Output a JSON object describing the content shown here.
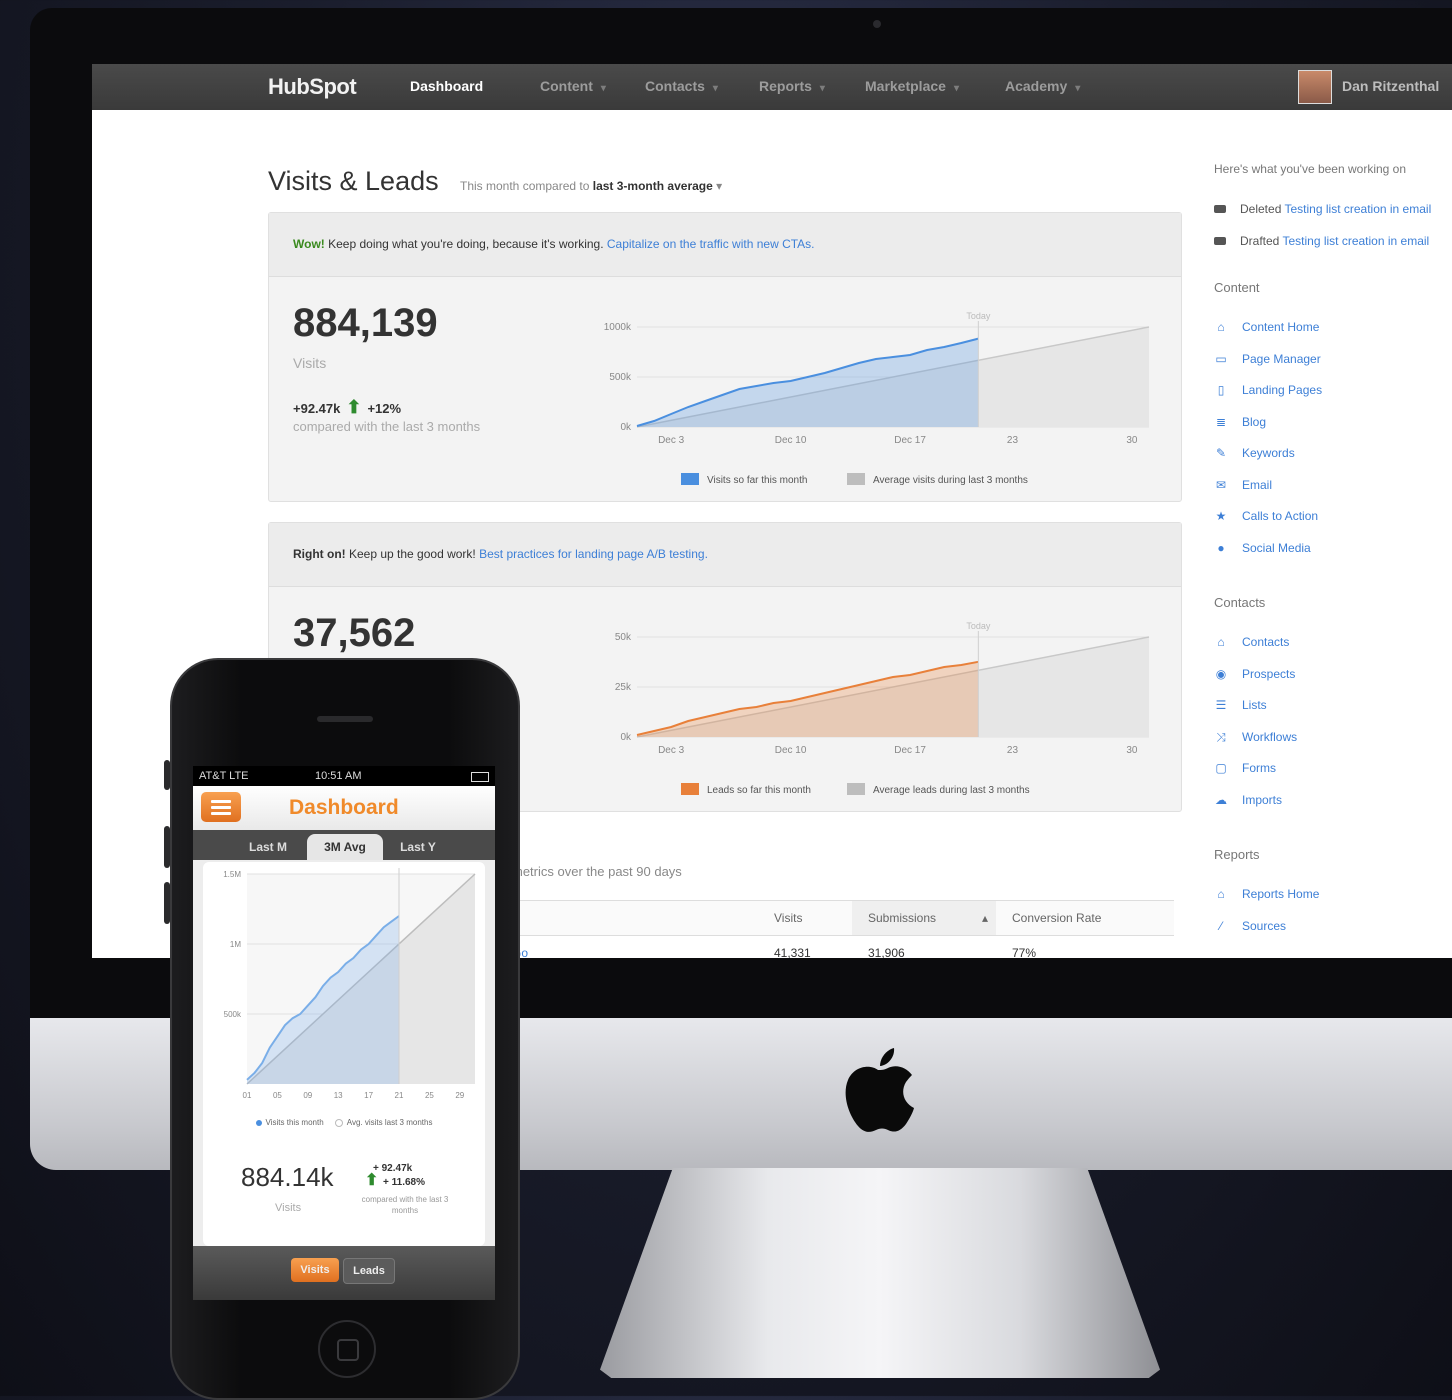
{
  "nav": {
    "logo": "HubSpot",
    "items": [
      {
        "label": "Dashboard",
        "active": true
      },
      {
        "label": "Content"
      },
      {
        "label": "Contacts"
      },
      {
        "label": "Reports"
      },
      {
        "label": "Marketplace"
      },
      {
        "label": "Academy"
      }
    ],
    "user": "Dan Ritzenthal"
  },
  "main": {
    "title": "Visits & Leads",
    "subtitle_prefix": "This month compared to",
    "subtitle_bold": "last 3-month average",
    "subtitle_caret": "▾"
  },
  "panels": [
    {
      "msg_strong": "Wow!",
      "msg": " Keep doing what you're doing, because it's working. ",
      "msg_link": "Capitalize on the traffic with new CTAs.",
      "value": "884,139",
      "label": "Visits",
      "delta_abs": "+92.47k",
      "delta_pct": "+12%",
      "delta_note": "compared with the last 3 months",
      "legend_this": "Visits so far this month",
      "legend_avg": "Average visits during last 3 months",
      "today": "Today"
    },
    {
      "msg_strong": "Right on!",
      "msg": " Keep up the good work! ",
      "msg_link": "Best practices for landing page A/B testing.",
      "value": "37,562",
      "label": "",
      "delta_abs": "",
      "delta_pct": "",
      "delta_note": "",
      "legend_this": "Leads so far this month",
      "legend_avg": "Average leads during last 3 months",
      "today": "Today"
    }
  ],
  "sidebar": {
    "intro": "Here's what you've been working on",
    "activity": [
      {
        "verb": "Deleted",
        "link": "Testing list creation in email"
      },
      {
        "verb": "Drafted",
        "link": "Testing list creation in email"
      }
    ],
    "sections": [
      {
        "heading": "Content",
        "items": [
          {
            "icon": "home-icon",
            "glyph": "⌂",
            "label": "Content Home"
          },
          {
            "icon": "page-icon",
            "glyph": "▭",
            "label": "Page Manager"
          },
          {
            "icon": "document-icon",
            "glyph": "▯",
            "label": "Landing Pages"
          },
          {
            "icon": "blog-icon",
            "glyph": "≣",
            "label": "Blog"
          },
          {
            "icon": "wrench-icon",
            "glyph": "✎",
            "label": "Keywords"
          },
          {
            "icon": "email-icon",
            "glyph": "✉",
            "label": "Email"
          },
          {
            "icon": "star-icon",
            "glyph": "★",
            "label": "Calls to Action"
          },
          {
            "icon": "speech-bubble-icon",
            "glyph": "●",
            "label": "Social Media"
          }
        ]
      },
      {
        "heading": "Contacts",
        "items": [
          {
            "icon": "home-icon",
            "glyph": "⌂",
            "label": "Contacts"
          },
          {
            "icon": "eye-icon",
            "glyph": "◉",
            "label": "Prospects"
          },
          {
            "icon": "list-icon",
            "glyph": "☰",
            "label": "Lists"
          },
          {
            "icon": "shuffle-icon",
            "glyph": "⤨",
            "label": "Workflows"
          },
          {
            "icon": "form-icon",
            "glyph": "▢",
            "label": "Forms"
          },
          {
            "icon": "cloud-upload-icon",
            "glyph": "☁",
            "label": "Imports"
          }
        ]
      },
      {
        "heading": "Reports",
        "items": [
          {
            "icon": "home-icon",
            "glyph": "⌂",
            "label": "Reports Home"
          },
          {
            "icon": "sources-icon",
            "glyph": "⁄",
            "label": "Sources"
          }
        ]
      }
    ]
  },
  "table": {
    "caption": "metrics over the past 90 days",
    "headers": [
      "Visits",
      "Submissions",
      "Conversion Rate"
    ],
    "sort_glyph": "▴",
    "row": {
      "name_tail": "Go",
      "visits": "41,331",
      "submissions": "31,906",
      "rate": "77%"
    }
  },
  "chart_data": [
    {
      "type": "area",
      "title": "",
      "xlabel": "",
      "ylabel": "",
      "x_ticks": [
        "Dec 3",
        "Dec 10",
        "Dec 17",
        "23",
        "30"
      ],
      "y_ticks": [
        "1000k",
        "500k",
        "0k"
      ],
      "ylim": [
        0,
        1000
      ],
      "xlim": [
        1,
        31
      ],
      "today": 21,
      "series": [
        {
          "name": "Visits so far this month",
          "color": "#4a8fdf",
          "x": [
            1,
            2,
            3,
            4,
            5,
            6,
            7,
            8,
            9,
            10,
            11,
            12,
            13,
            14,
            15,
            16,
            17,
            18,
            19,
            20,
            21
          ],
          "y": [
            10,
            60,
            130,
            200,
            260,
            320,
            380,
            410,
            440,
            460,
            500,
            540,
            590,
            640,
            680,
            700,
            720,
            770,
            800,
            840,
            884
          ]
        },
        {
          "name": "Average visits during last 3 months",
          "color": "#c8c8c8",
          "x": [
            1,
            31
          ],
          "y": [
            0,
            1200
          ]
        }
      ]
    },
    {
      "type": "area",
      "title": "",
      "xlabel": "",
      "ylabel": "",
      "x_ticks": [
        "Dec 3",
        "Dec 10",
        "Dec 17",
        "23",
        "30"
      ],
      "y_ticks": [
        "50k",
        "25k",
        "0k"
      ],
      "ylim": [
        0,
        50
      ],
      "xlim": [
        1,
        31
      ],
      "today": 21,
      "series": [
        {
          "name": "Leads so far this month",
          "color": "#e8803a",
          "x": [
            1,
            2,
            3,
            4,
            5,
            6,
            7,
            8,
            9,
            10,
            11,
            12,
            13,
            14,
            15,
            16,
            17,
            18,
            19,
            20,
            21
          ],
          "y": [
            1,
            3,
            5,
            8,
            10,
            12,
            14,
            15,
            17,
            18,
            20,
            22,
            24,
            26,
            28,
            30,
            31,
            33,
            35,
            36,
            37.6
          ]
        },
        {
          "name": "Average leads during last 3 months",
          "color": "#c8c8c8",
          "x": [
            1,
            31
          ],
          "y": [
            0,
            60
          ]
        }
      ]
    },
    {
      "type": "area",
      "title": "",
      "xlabel": "",
      "ylabel": "",
      "x_ticks": [
        "01",
        "05",
        "09",
        "13",
        "17",
        "21",
        "25",
        "29"
      ],
      "y_ticks": [
        "1.5M",
        "1M",
        "500k"
      ],
      "ylim": [
        0,
        1500
      ],
      "xlim": [
        1,
        31
      ],
      "today": 21,
      "series": [
        {
          "name": "Visits this month",
          "color": "#7aaee8",
          "x": [
            1,
            2,
            3,
            4,
            5,
            6,
            7,
            8,
            9,
            10,
            11,
            12,
            13,
            14,
            15,
            16,
            17,
            18,
            19,
            20,
            21
          ],
          "y": [
            30,
            80,
            150,
            260,
            340,
            420,
            470,
            500,
            560,
            620,
            700,
            760,
            800,
            860,
            900,
            960,
            1000,
            1060,
            1120,
            1160,
            1200
          ]
        },
        {
          "name": "Avg. visits last 3 months",
          "color": "#bdbdbd",
          "x": [
            1,
            31
          ],
          "y": [
            0,
            1500
          ]
        }
      ]
    }
  ],
  "phone": {
    "carrier": "AT&T LTE",
    "time": "10:51 AM",
    "title": "Dashboard",
    "tabs": [
      "Last M",
      "3M Avg",
      "Last Y"
    ],
    "active_tab": 1,
    "legend_this": "Visits this month",
    "legend_avg": "Avg. visits last 3 months",
    "value": "884.14k",
    "label": "Visits",
    "delta_abs": "+ 92.47k",
    "delta_pct": "+ 11.68%",
    "delta_note": "compared with the last 3 months",
    "segments": [
      "Visits",
      "Leads"
    ]
  },
  "colors": {
    "brand_orange": "#f08a2a",
    "link_blue": "#3d7fd6",
    "visits_blue": "#4a8fdf",
    "leads_orange": "#e8803a",
    "good_green": "#3a8a1e"
  }
}
